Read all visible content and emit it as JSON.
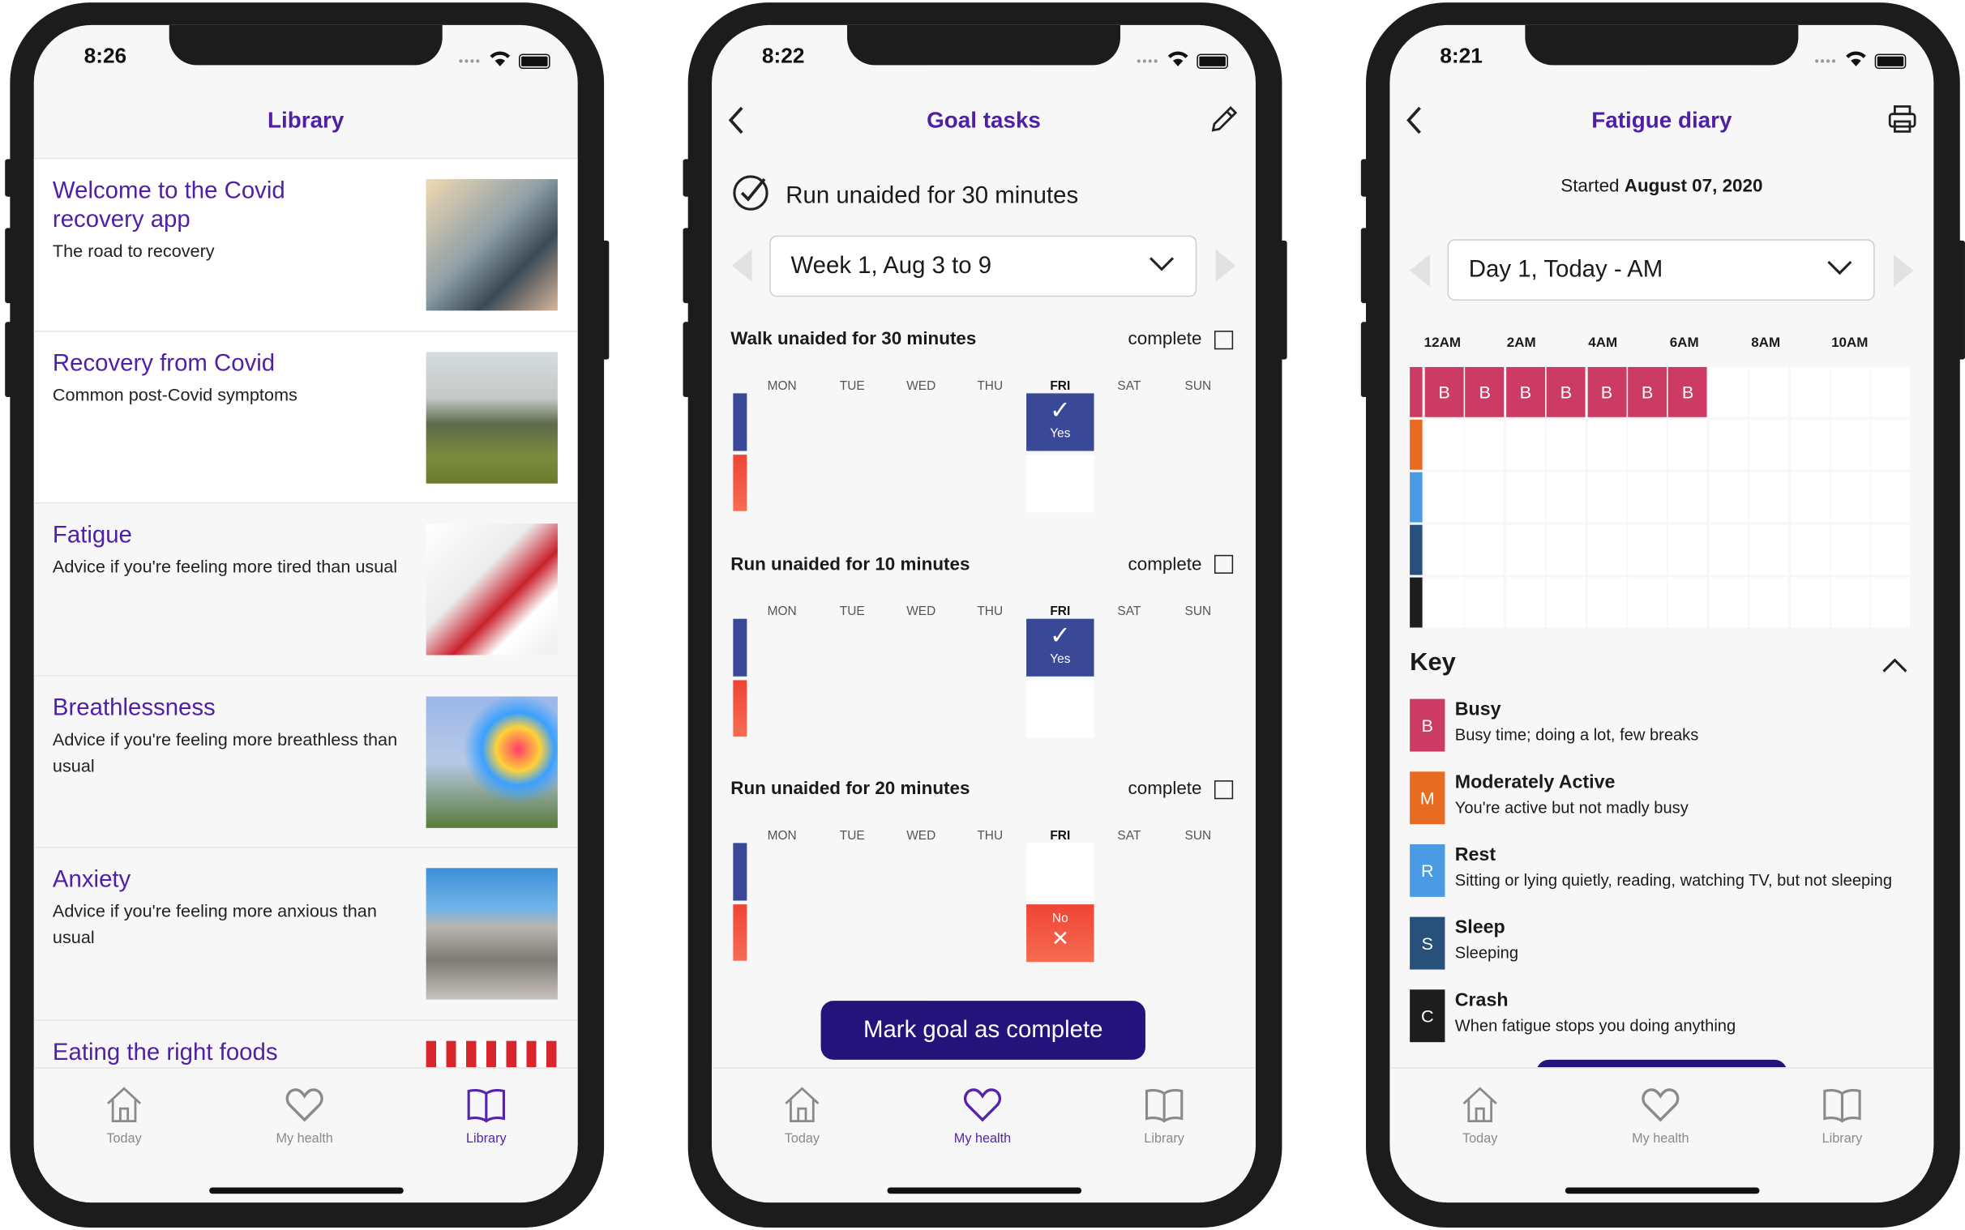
{
  "colors": {
    "accent": "#4f1fa8",
    "button": "#25137c",
    "yes": "#3a4898",
    "no": "#f04a3a",
    "busy": "#cc3b63",
    "moderate": "#e86b22",
    "rest": "#4a9be4",
    "sleep": "#27507a",
    "crash": "#1d1d1d"
  },
  "tabs": [
    {
      "label": "Today",
      "icon": "home-icon"
    },
    {
      "label": "My health",
      "icon": "heart-icon"
    },
    {
      "label": "Library",
      "icon": "book-icon"
    }
  ],
  "library": {
    "time": "8:26",
    "title": "Library",
    "active_tab": 2,
    "items": [
      {
        "title": "Welcome to the Covid recovery app",
        "subtitle": "The road to recovery",
        "image": "phone-in-hand"
      },
      {
        "title": "Recovery from Covid",
        "subtitle": "Common post-Covid symptoms",
        "image": "mountain-landscape"
      },
      {
        "title": "Fatigue",
        "subtitle": "Advice if you're feeling more tired than usual",
        "image": "toothpaste-tube"
      },
      {
        "title": "Breathlessness",
        "subtitle": "Advice if you're feeling more breathless than usual",
        "image": "pinwheel"
      },
      {
        "title": "Anxiety",
        "subtitle": "Advice if you're feeling more anxious than usual",
        "image": "stacked-rocks"
      },
      {
        "title": "Eating the right foods",
        "subtitle": "",
        "image": "checkered-tablecloth"
      }
    ]
  },
  "goals": {
    "time": "8:22",
    "title": "Goal tasks",
    "active_tab": 1,
    "goal": "Run unaided for 30 minutes",
    "week": "Week 1, Aug 3 to 9",
    "days": [
      "MON",
      "TUE",
      "WED",
      "THU",
      "FRI",
      "SAT",
      "SUN"
    ],
    "complete_label": "complete",
    "tasks": [
      {
        "title": "Walk unaided for 30 minutes",
        "fri": "Yes",
        "complete": false
      },
      {
        "title": "Run unaided for 10 minutes",
        "fri": "Yes",
        "complete": false
      },
      {
        "title": "Run unaided for 20 minutes",
        "fri": "No",
        "complete": false
      }
    ],
    "button": "Mark goal as complete"
  },
  "diary": {
    "time": "8:21",
    "title": "Fatigue diary",
    "started_prefix": "Started ",
    "started_date": "August 07, 2020",
    "day": "Day 1, Today - AM",
    "hours": [
      "12AM",
      "2AM",
      "4AM",
      "6AM",
      "8AM",
      "10AM"
    ],
    "busy_slots": 7,
    "slot_letter": "B",
    "key_title": "Key",
    "key": [
      {
        "letter": "B",
        "title": "Busy",
        "desc": "Busy time; doing a lot, few breaks",
        "color": "#cc3b63"
      },
      {
        "letter": "M",
        "title": "Moderately Active",
        "desc": "You're active but not madly busy",
        "color": "#e86b22"
      },
      {
        "letter": "R",
        "title": "Rest",
        "desc": "Sitting or lying quietly, reading, watching TV, but not sleeping",
        "color": "#4a9be4"
      },
      {
        "letter": "S",
        "title": "Sleep",
        "desc": "Sleeping",
        "color": "#27507a"
      },
      {
        "letter": "C",
        "title": "Crash",
        "desc": "When fatigue stops you doing anything",
        "color": "#1d1d1d"
      }
    ]
  }
}
